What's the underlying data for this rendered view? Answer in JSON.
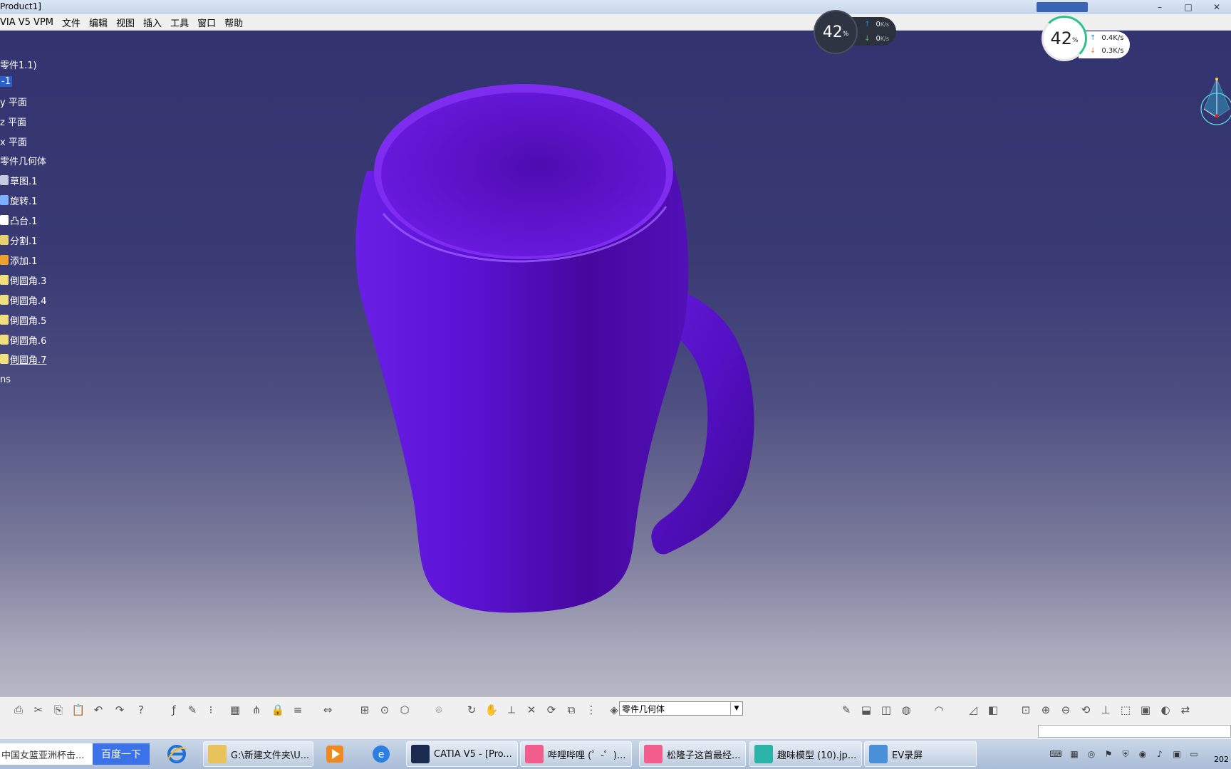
{
  "window": {
    "title": "Product1]"
  },
  "menu": [
    "VIA V5 VPM",
    "文件",
    "编辑",
    "视图",
    "插入",
    "工具",
    "窗口",
    "帮助"
  ],
  "tree": [
    {
      "label": "零件1.1)",
      "icon": "part-icon"
    },
    {
      "label": "-1",
      "icon": "selected-node"
    },
    {
      "label": "y 平面",
      "icon": "plane-icon"
    },
    {
      "label": "z 平面",
      "icon": "plane-icon"
    },
    {
      "label": "x 平面",
      "icon": "plane-icon"
    },
    {
      "label": "零件几何体",
      "icon": "body-icon"
    },
    {
      "label": "草图.1",
      "icon": "sketch-icon"
    },
    {
      "label": "旋转.1",
      "icon": "revolve-icon"
    },
    {
      "label": "凸台.1",
      "icon": "pad-icon"
    },
    {
      "label": "分割.1",
      "icon": "split-icon"
    },
    {
      "label": "添加.1",
      "icon": "add-icon"
    },
    {
      "label": "倒圆角.3",
      "icon": "fillet-icon"
    },
    {
      "label": "倒圆角.4",
      "icon": "fillet-icon"
    },
    {
      "label": "倒圆角.5",
      "icon": "fillet-icon"
    },
    {
      "label": "倒圆角.6",
      "icon": "fillet-icon"
    },
    {
      "label": "倒圆角.7",
      "icon": "fillet-icon"
    },
    {
      "label": "ns",
      "icon": "none"
    }
  ],
  "net_widget_dark": {
    "percent": "42",
    "unit": "%",
    "up": "0",
    "down": "0",
    "rate_unit": "K/s"
  },
  "net_widget_light": {
    "percent": "42",
    "unit": "%",
    "up": "0.4K/s",
    "down": "0.3K/s"
  },
  "toolbar": {
    "body_select": "零件几何体",
    "icons": [
      "print-icon",
      "cut-icon",
      "copy-icon",
      "paste-icon",
      "undo-icon",
      "redo-icon",
      "whats-this-icon",
      "formula-icon",
      "comment-icon",
      "knowledge-icon",
      "table-icon",
      "tree-icon",
      "lock-icon",
      "param-icon",
      "measure-icon",
      "dimension-icon",
      "compass-icon",
      "inertia-icon",
      "camera-icon",
      "fly-icon",
      "pan-icon",
      "axis-icon",
      "cross-icon",
      "sync-icon",
      "update-icon",
      "list-icon",
      "body-icon",
      "sketch-icon",
      "pad-icon",
      "pocket-icon",
      "shaft-icon",
      "fillet-icon",
      "draft-icon",
      "shell-icon",
      "fit-all-icon",
      "zoom-in-icon",
      "zoom-out-icon",
      "rotate-icon",
      "normal-view-icon",
      "iso-view-icon",
      "shading-icon",
      "hide-show-icon",
      "swap-icon"
    ]
  },
  "taskbar": {
    "search_text": "中国女篮亚洲杯击...",
    "search_button": "百度一下",
    "buttons": [
      {
        "label": "G:\\新建文件夹\\U...",
        "icon": "folder-icon",
        "color": "#e8c25a"
      },
      {
        "label": "CATIA V5 - [Pro...",
        "icon": "catia-icon",
        "color": "#1b2b50"
      },
      {
        "label": "哔哩哔哩 (゜-゜)...",
        "icon": "bilibili-icon",
        "color": "#f25d8e"
      },
      {
        "label": "松隆子这首最经...",
        "icon": "bilibili-icon",
        "color": "#f25d8e"
      },
      {
        "label": "趣味模型 (10).jp...",
        "icon": "image-viewer-icon",
        "color": "#2bb3a8"
      },
      {
        "label": "EV录屏",
        "icon": "ev-recorder-icon",
        "color": "#4a8fd8"
      }
    ],
    "clock": "202"
  },
  "colors": {
    "mug": "#5a10c8",
    "viewport_top": "#32336f",
    "viewport_bottom": "#b8b8c6"
  }
}
